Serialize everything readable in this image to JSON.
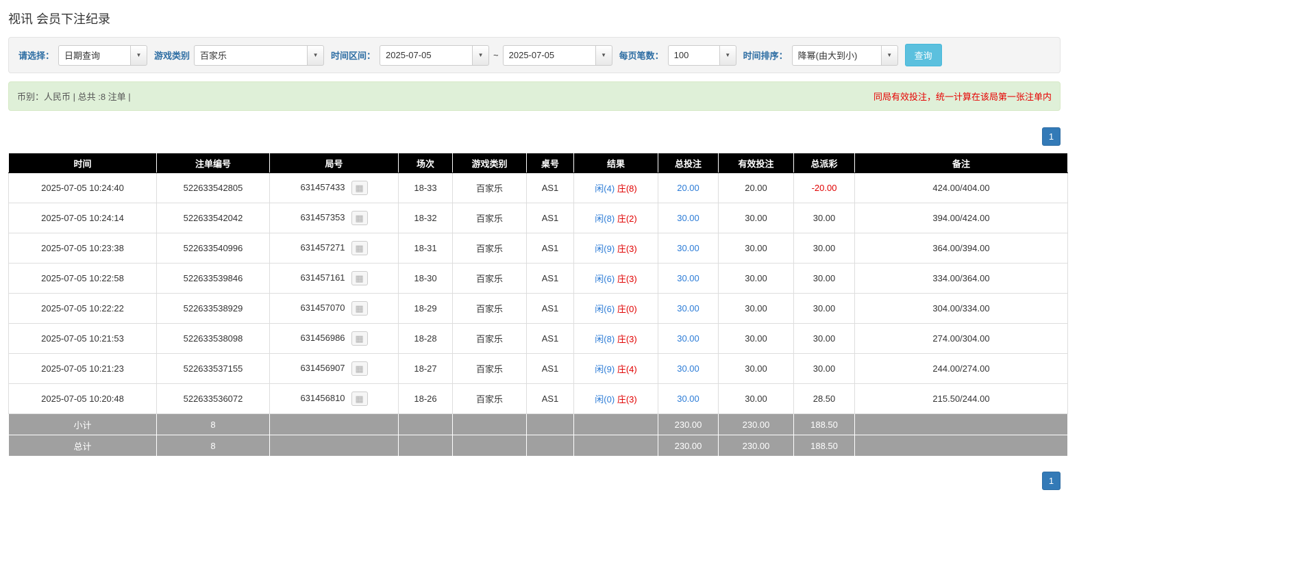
{
  "page": {
    "title": "视讯 会员下注纪录"
  },
  "icons": {
    "dropdown_glyph": "▼",
    "roadmap_glyph": "▦"
  },
  "colors": {
    "label_blue": "#2d6da3",
    "link_blue": "#2b7bd6",
    "banker_red": "#e00000",
    "negative_red": "#e00000",
    "header_bg": "#000000",
    "footer_bg": "#a0a0a0",
    "search_button_bg": "#5bc0de",
    "pager_bg": "#337ab7",
    "alert_bg": "#dff0d8"
  },
  "filters": {
    "select_label": "请选择：",
    "select_value": "日期查询",
    "game_type_label": "游戏类别",
    "game_type_value": "百家乐",
    "time_range_label": "时间区间：",
    "time_from": "2025-07-05",
    "tilde": "~",
    "time_to": "2025-07-05",
    "page_size_label": "每页笔数：",
    "page_size_value": "100",
    "sort_label": "时间排序：",
    "sort_value": "降幂(由大到小)",
    "search_button": "查询"
  },
  "summary": {
    "left": "币别：人民币 | 总共 :8 注单 |",
    "right": "同局有效投注，统一计算在该局第一张注单内"
  },
  "pagination": {
    "page": "1"
  },
  "table": {
    "headers": [
      "时间",
      "注单编号",
      "局号",
      "场次",
      "游戏类别",
      "桌号",
      "结果",
      "总投注",
      "有效投注",
      "总派彩",
      "备注"
    ],
    "rows": [
      {
        "time": "2025-07-05 10:24:40",
        "bet_id": "522633542805",
        "round_id": "631457433",
        "session": "18-33",
        "game": "百家乐",
        "table_no": "AS1",
        "result_player": "闲(4)",
        "result_banker": "庄(8)",
        "total_bet": "20.00",
        "valid_bet": "20.00",
        "payout": "-20.00",
        "remark": "424.00/404.00"
      },
      {
        "time": "2025-07-05 10:24:14",
        "bet_id": "522633542042",
        "round_id": "631457353",
        "session": "18-32",
        "game": "百家乐",
        "table_no": "AS1",
        "result_player": "闲(8)",
        "result_banker": "庄(2)",
        "total_bet": "30.00",
        "valid_bet": "30.00",
        "payout": "30.00",
        "remark": "394.00/424.00"
      },
      {
        "time": "2025-07-05 10:23:38",
        "bet_id": "522633540996",
        "round_id": "631457271",
        "session": "18-31",
        "game": "百家乐",
        "table_no": "AS1",
        "result_player": "闲(9)",
        "result_banker": "庄(3)",
        "total_bet": "30.00",
        "valid_bet": "30.00",
        "payout": "30.00",
        "remark": "364.00/394.00"
      },
      {
        "time": "2025-07-05 10:22:58",
        "bet_id": "522633539846",
        "round_id": "631457161",
        "session": "18-30",
        "game": "百家乐",
        "table_no": "AS1",
        "result_player": "闲(6)",
        "result_banker": "庄(3)",
        "total_bet": "30.00",
        "valid_bet": "30.00",
        "payout": "30.00",
        "remark": "334.00/364.00"
      },
      {
        "time": "2025-07-05 10:22:22",
        "bet_id": "522633538929",
        "round_id": "631457070",
        "session": "18-29",
        "game": "百家乐",
        "table_no": "AS1",
        "result_player": "闲(6)",
        "result_banker": "庄(0)",
        "total_bet": "30.00",
        "valid_bet": "30.00",
        "payout": "30.00",
        "remark": "304.00/334.00"
      },
      {
        "time": "2025-07-05 10:21:53",
        "bet_id": "522633538098",
        "round_id": "631456986",
        "session": "18-28",
        "game": "百家乐",
        "table_no": "AS1",
        "result_player": "闲(8)",
        "result_banker": "庄(3)",
        "total_bet": "30.00",
        "valid_bet": "30.00",
        "payout": "30.00",
        "remark": "274.00/304.00"
      },
      {
        "time": "2025-07-05 10:21:23",
        "bet_id": "522633537155",
        "round_id": "631456907",
        "session": "18-27",
        "game": "百家乐",
        "table_no": "AS1",
        "result_player": "闲(9)",
        "result_banker": "庄(4)",
        "total_bet": "30.00",
        "valid_bet": "30.00",
        "payout": "30.00",
        "remark": "244.00/274.00"
      },
      {
        "time": "2025-07-05 10:20:48",
        "bet_id": "522633536072",
        "round_id": "631456810",
        "session": "18-26",
        "game": "百家乐",
        "table_no": "AS1",
        "result_player": "闲(0)",
        "result_banker": "庄(3)",
        "total_bet": "30.00",
        "valid_bet": "30.00",
        "payout": "28.50",
        "remark": "215.50/244.00"
      }
    ],
    "subtotal": {
      "label": "小计",
      "count": "8",
      "total_bet": "230.00",
      "valid_bet": "230.00",
      "payout": "188.50"
    },
    "total": {
      "label": "总计",
      "count": "8",
      "total_bet": "230.00",
      "valid_bet": "230.00",
      "payout": "188.50"
    }
  }
}
